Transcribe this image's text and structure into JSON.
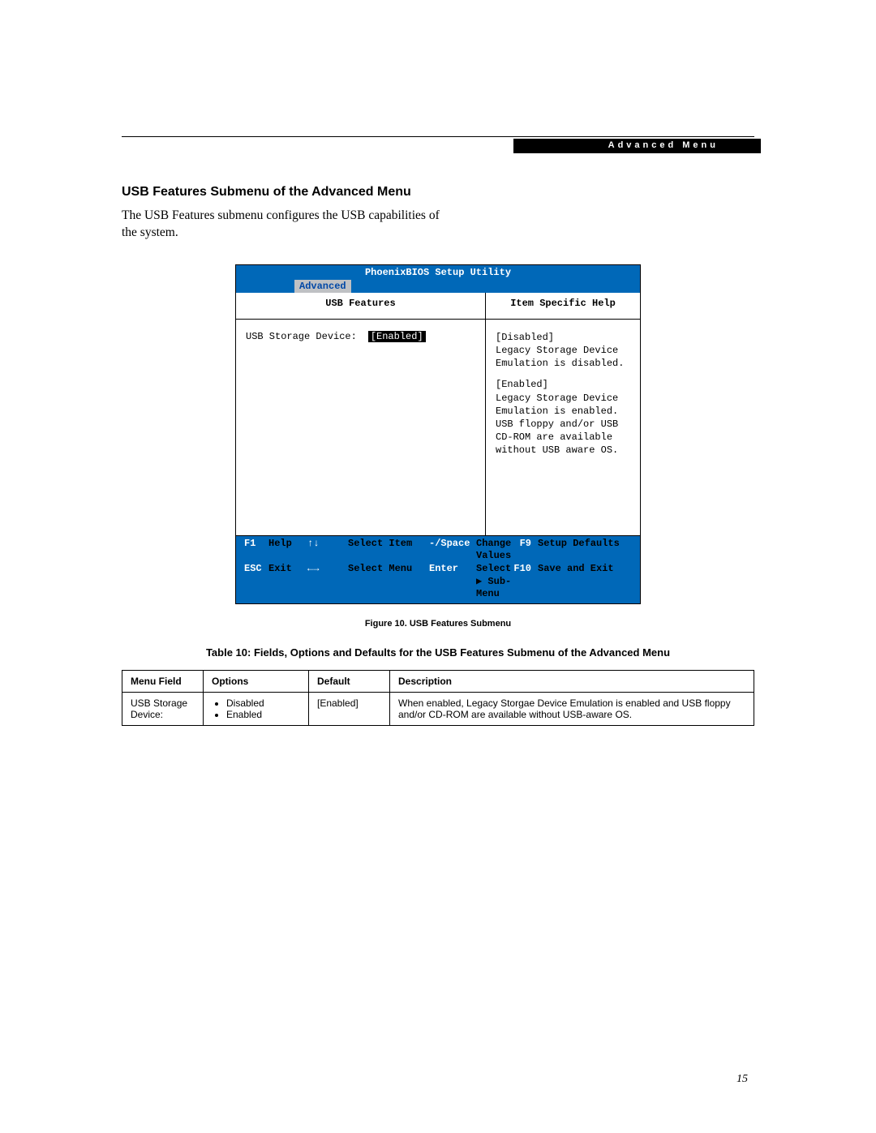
{
  "header": {
    "breadcrumb": "Advanced Menu"
  },
  "section": {
    "title": "USB Features Submenu of the Advanced Menu",
    "intro": "The USB Features submenu configures the USB capabilities of the system."
  },
  "bios": {
    "utility_title": "PhoenixBIOS Setup Utility",
    "active_tab": "Advanced",
    "left_pane_title": "USB Features",
    "right_pane_title": "Item Specific Help",
    "field_label": "USB Storage Device:",
    "field_value": "[Enabled]",
    "help": {
      "disabled_label": "[Disabled]",
      "disabled_text": "Legacy Storage Device Emulation is disabled.",
      "enabled_label": "[Enabled]",
      "enabled_text": "Legacy Storage Device Emulation is enabled. USB floppy and/or USB CD-ROM are available without USB aware OS."
    },
    "footer": {
      "r1": {
        "k1": "F1",
        "a1": "Help",
        "arrows1": "↑↓",
        "act1": "Select Item",
        "k2": "-/Space",
        "a2": "Change Values",
        "k3": "F9",
        "a3": "Setup Defaults"
      },
      "r2": {
        "k1": "ESC",
        "a1": "Exit",
        "arrows1": "←→",
        "act1": "Select Menu",
        "k2": "Enter",
        "a2": "Select ▶ Sub-Menu",
        "k3": "F10",
        "a3": "Save and Exit"
      }
    }
  },
  "figure_caption": "Figure 10.  USB Features Submenu",
  "table_title": "Table 10: Fields, Options and Defaults for the USB Features Submenu of the Advanced Menu",
  "table": {
    "headers": {
      "c1": "Menu Field",
      "c2": "Options",
      "c3": "Default",
      "c4": "Description"
    },
    "row": {
      "menu_field": "USB Storage Device:",
      "options": [
        "Disabled",
        "Enabled"
      ],
      "default": "[Enabled]",
      "description": "When enabled, Legacy Storgae Device Emulation is enabled and USB floppy and/or CD-ROM are available without USB-aware OS."
    }
  },
  "page_number": "15"
}
